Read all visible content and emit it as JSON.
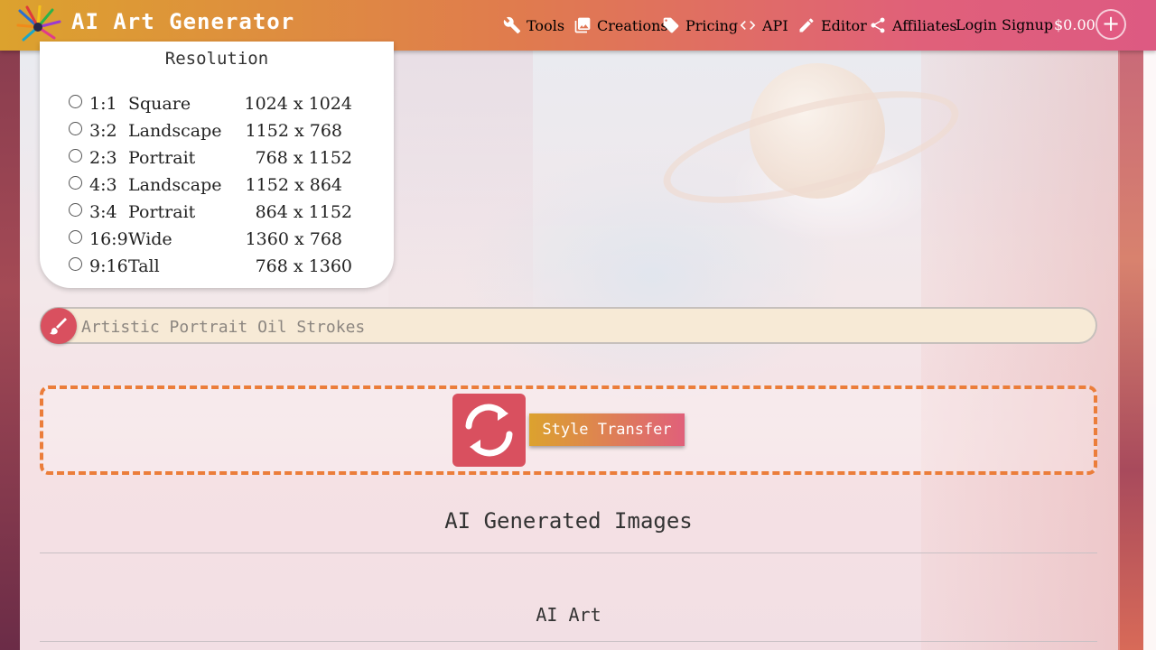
{
  "header": {
    "brand": "AI Art Generator",
    "nav": [
      {
        "label": "Tools",
        "icon": "wrench-icon"
      },
      {
        "label": "Creations",
        "icon": "images-icon"
      },
      {
        "label": "Pricing",
        "icon": "tag-icon"
      },
      {
        "label": "API",
        "icon": "code-icon"
      },
      {
        "label": "Editor",
        "icon": "pencil-icon"
      },
      {
        "label": "Affiliates",
        "icon": "share-icon"
      },
      {
        "label": "Login"
      },
      {
        "label": "Signup"
      }
    ],
    "balance": "$0.00",
    "plus_label": "+"
  },
  "resolution": {
    "title": "Resolution",
    "options": [
      {
        "ratio": "1:1",
        "name": "Square",
        "dims": "1024 x 1024"
      },
      {
        "ratio": "3:2",
        "name": "Landscape",
        "dims": "1152 x 768"
      },
      {
        "ratio": "2:3",
        "name": "Portrait",
        "dims": "768 x 1152"
      },
      {
        "ratio": "4:3",
        "name": "Landscape",
        "dims": "1152 x 864"
      },
      {
        "ratio": "3:4",
        "name": "Portrait",
        "dims": "864 x 1152"
      },
      {
        "ratio": "16:9",
        "name": "Wide",
        "dims": "1360 x 768"
      },
      {
        "ratio": "9:16",
        "name": "Tall",
        "dims": "768 x 1360"
      }
    ]
  },
  "style": {
    "placeholder": "Artistic Portrait Oil Strokes"
  },
  "upload": {
    "button_label": "Style Transfer"
  },
  "sections": {
    "generated_title": "AI Generated Images",
    "art_title": "AI Art"
  },
  "colors": {
    "accent_orange": "#eb7d3a",
    "accent_red": "#d9505f",
    "header_start": "#dca22e",
    "header_end": "#dd5a82"
  }
}
